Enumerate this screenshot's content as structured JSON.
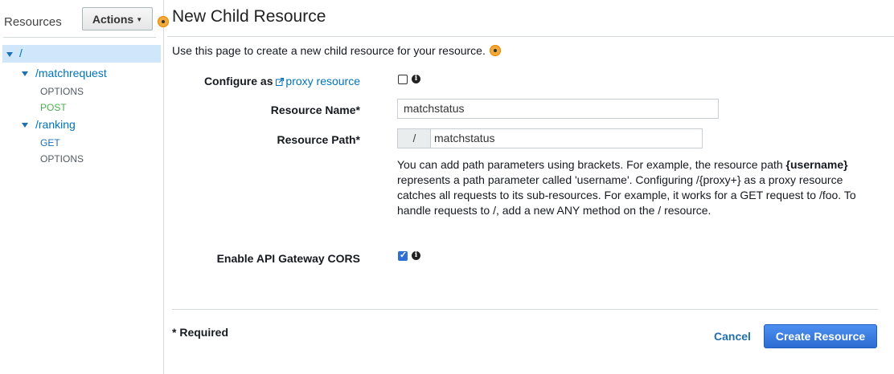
{
  "sidebar": {
    "title": "Resources",
    "actions_label": "Actions",
    "tree": {
      "root": "/",
      "matchrequest": "/matchrequest",
      "matchrequest_methods": [
        "OPTIONS",
        "POST"
      ],
      "ranking": "/ranking",
      "ranking_methods": [
        "GET",
        "OPTIONS"
      ]
    }
  },
  "main": {
    "title": "New Child Resource",
    "intro": "Use this page to create a new child resource for your resource.",
    "configure_as": "Configure as",
    "proxy_resource_link": "proxy resource",
    "proxy_checked": false,
    "resource_name_label": "Resource Name*",
    "resource_name_value": "matchstatus",
    "resource_path_label": "Resource Path*",
    "resource_path_prefix": "/",
    "resource_path_value": "matchstatus",
    "help_text_1": "You can add path parameters using brackets. For example, the resource path ",
    "help_text_bold": "{username}",
    "help_text_2": " represents a path parameter called 'username'. Configuring /{proxy+} as a proxy resource catches all requests to its sub-resources. For example, it works for a GET request to /foo. To handle requests to /, add a new ANY method on the / resource.",
    "cors_label": "Enable API Gateway CORS",
    "cors_checked": true,
    "required_note": "* Required",
    "cancel_label": "Cancel",
    "create_label": "Create Resource"
  },
  "colors": {
    "link_blue": "#0073bb",
    "post_green": "#4caf50",
    "get_blue": "#1f6fb3",
    "primary_button": "#2c6cd2",
    "selected_row": "#cfe6fb",
    "orange_marker": "#f2a93b"
  },
  "icons": [
    "caret-down-icon",
    "tree-expand-icon",
    "external-link-icon",
    "info-icon",
    "orange-marker-icon"
  ]
}
